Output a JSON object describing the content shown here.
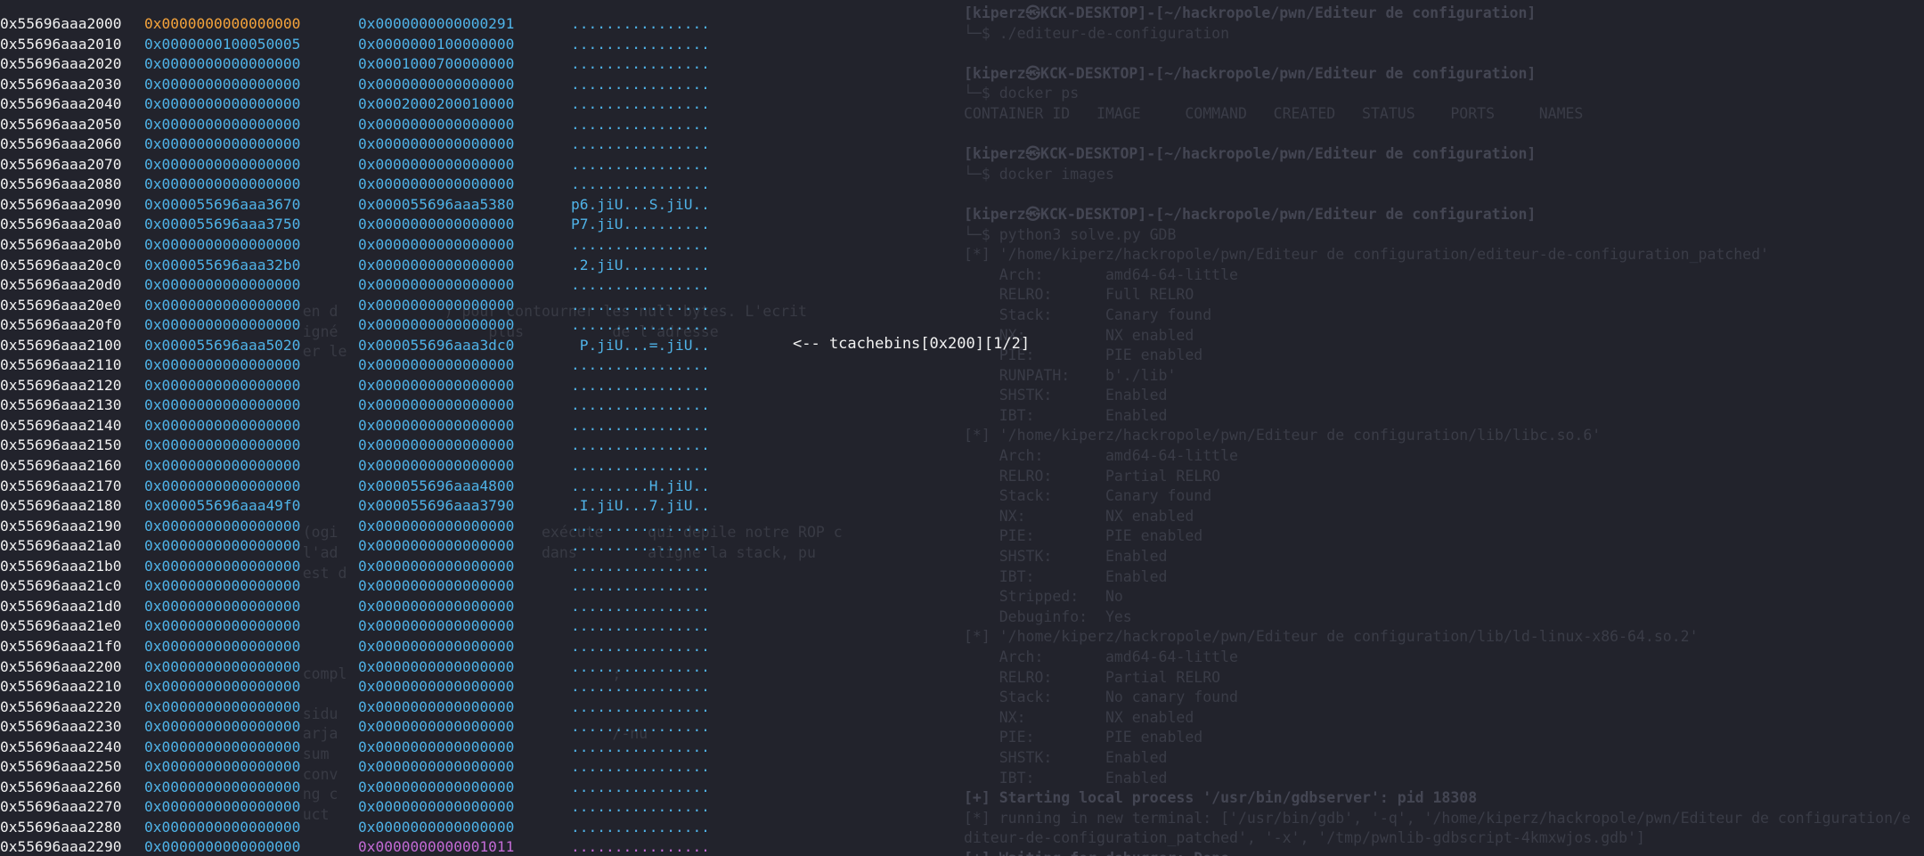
{
  "hexdump": {
    "rows": [
      {
        "addr": "0x55696aaa2000",
        "q1": "0x0000000000000000",
        "q2": "0x0000000000000291",
        "ascii": "................"
      },
      {
        "addr": "0x55696aaa2010",
        "q1": "0x0000000100050005",
        "q2": "0x0000000100000000",
        "ascii": "................"
      },
      {
        "addr": "0x55696aaa2020",
        "q1": "0x0000000000000000",
        "q2": "0x0001000700000000",
        "ascii": "................"
      },
      {
        "addr": "0x55696aaa2030",
        "q1": "0x0000000000000000",
        "q2": "0x0000000000000000",
        "ascii": "................"
      },
      {
        "addr": "0x55696aaa2040",
        "q1": "0x0000000000000000",
        "q2": "0x0002000200010000",
        "ascii": "................"
      },
      {
        "addr": "0x55696aaa2050",
        "q1": "0x0000000000000000",
        "q2": "0x0000000000000000",
        "ascii": "................"
      },
      {
        "addr": "0x55696aaa2060",
        "q1": "0x0000000000000000",
        "q2": "0x0000000000000000",
        "ascii": "................"
      },
      {
        "addr": "0x55696aaa2070",
        "q1": "0x0000000000000000",
        "q2": "0x0000000000000000",
        "ascii": "................"
      },
      {
        "addr": "0x55696aaa2080",
        "q1": "0x0000000000000000",
        "q2": "0x0000000000000000",
        "ascii": "................"
      },
      {
        "addr": "0x55696aaa2090",
        "q1": "0x000055696aaa3670",
        "q2": "0x000055696aaa5380",
        "ascii": "p6.jiU...S.jiU.."
      },
      {
        "addr": "0x55696aaa20a0",
        "q1": "0x000055696aaa3750",
        "q2": "0x0000000000000000",
        "ascii": "P7.jiU.........."
      },
      {
        "addr": "0x55696aaa20b0",
        "q1": "0x0000000000000000",
        "q2": "0x0000000000000000",
        "ascii": "................"
      },
      {
        "addr": "0x55696aaa20c0",
        "q1": "0x000055696aaa32b0",
        "q2": "0x0000000000000000",
        "ascii": ".2.jiU.........."
      },
      {
        "addr": "0x55696aaa20d0",
        "q1": "0x0000000000000000",
        "q2": "0x0000000000000000",
        "ascii": "................"
      },
      {
        "addr": "0x55696aaa20e0",
        "q1": "0x0000000000000000",
        "q2": "0x0000000000000000",
        "ascii": "................"
      },
      {
        "addr": "0x55696aaa20f0",
        "q1": "0x0000000000000000",
        "q2": "0x0000000000000000",
        "ascii": "................"
      },
      {
        "addr": "0x55696aaa2100",
        "q1": "0x000055696aaa5020",
        "q2": "0x000055696aaa3dc0",
        "ascii": " P.jiU...=.jiU.."
      },
      {
        "addr": "0x55696aaa2110",
        "q1": "0x0000000000000000",
        "q2": "0x0000000000000000",
        "ascii": "................"
      },
      {
        "addr": "0x55696aaa2120",
        "q1": "0x0000000000000000",
        "q2": "0x0000000000000000",
        "ascii": "................"
      },
      {
        "addr": "0x55696aaa2130",
        "q1": "0x0000000000000000",
        "q2": "0x0000000000000000",
        "ascii": "................"
      },
      {
        "addr": "0x55696aaa2140",
        "q1": "0x0000000000000000",
        "q2": "0x0000000000000000",
        "ascii": "................"
      },
      {
        "addr": "0x55696aaa2150",
        "q1": "0x0000000000000000",
        "q2": "0x0000000000000000",
        "ascii": "................"
      },
      {
        "addr": "0x55696aaa2160",
        "q1": "0x0000000000000000",
        "q2": "0x0000000000000000",
        "ascii": "................"
      },
      {
        "addr": "0x55696aaa2170",
        "q1": "0x0000000000000000",
        "q2": "0x000055696aaa4800",
        "ascii": ".........H.jiU.."
      },
      {
        "addr": "0x55696aaa2180",
        "q1": "0x000055696aaa49f0",
        "q2": "0x000055696aaa3790",
        "ascii": ".I.jiU...7.jiU.."
      },
      {
        "addr": "0x55696aaa2190",
        "q1": "0x0000000000000000",
        "q2": "0x0000000000000000",
        "ascii": "................"
      },
      {
        "addr": "0x55696aaa21a0",
        "q1": "0x0000000000000000",
        "q2": "0x0000000000000000",
        "ascii": "................"
      },
      {
        "addr": "0x55696aaa21b0",
        "q1": "0x0000000000000000",
        "q2": "0x0000000000000000",
        "ascii": "................"
      },
      {
        "addr": "0x55696aaa21c0",
        "q1": "0x0000000000000000",
        "q2": "0x0000000000000000",
        "ascii": "................"
      },
      {
        "addr": "0x55696aaa21d0",
        "q1": "0x0000000000000000",
        "q2": "0x0000000000000000",
        "ascii": "................"
      },
      {
        "addr": "0x55696aaa21e0",
        "q1": "0x0000000000000000",
        "q2": "0x0000000000000000",
        "ascii": "................"
      },
      {
        "addr": "0x55696aaa21f0",
        "q1": "0x0000000000000000",
        "q2": "0x0000000000000000",
        "ascii": "................"
      },
      {
        "addr": "0x55696aaa2200",
        "q1": "0x0000000000000000",
        "q2": "0x0000000000000000",
        "ascii": "................"
      },
      {
        "addr": "0x55696aaa2210",
        "q1": "0x0000000000000000",
        "q2": "0x0000000000000000",
        "ascii": "................"
      },
      {
        "addr": "0x55696aaa2220",
        "q1": "0x0000000000000000",
        "q2": "0x0000000000000000",
        "ascii": "................"
      },
      {
        "addr": "0x55696aaa2230",
        "q1": "0x0000000000000000",
        "q2": "0x0000000000000000",
        "ascii": "................"
      },
      {
        "addr": "0x55696aaa2240",
        "q1": "0x0000000000000000",
        "q2": "0x0000000000000000",
        "ascii": "................"
      },
      {
        "addr": "0x55696aaa2250",
        "q1": "0x0000000000000000",
        "q2": "0x0000000000000000",
        "ascii": "................"
      },
      {
        "addr": "0x55696aaa2260",
        "q1": "0x0000000000000000",
        "q2": "0x0000000000000000",
        "ascii": "................"
      },
      {
        "addr": "0x55696aaa2270",
        "q1": "0x0000000000000000",
        "q2": "0x0000000000000000",
        "ascii": "................"
      },
      {
        "addr": "0x55696aaa2280",
        "q1": "0x0000000000000000",
        "q2": "0x0000000000000000",
        "ascii": "................"
      },
      {
        "addr": "0x55696aaa2290",
        "q1": "0x0000000000000000",
        "q2": "0x0000000000001011",
        "ascii": "................"
      }
    ],
    "annotation": "<-- tcachebins[0x200][1/2]"
  },
  "colors": {
    "background": "#22232c",
    "address": "#f2f2f2",
    "value": "#4fb3e8",
    "chunk_header": "#f5a33b",
    "top_chunk": "#c46bd6"
  },
  "background_terminal": {
    "right": [
      "[kiperz㉿KCK-DESKTOP]-[~/hackropole/pwn/Editeur de configuration]",
      "└─$ ./editeur-de-configuration",
      "",
      "[kiperz㉿KCK-DESKTOP]-[~/hackropole/pwn/Editeur de configuration]",
      "└─$ docker ps",
      "CONTAINER ID   IMAGE     COMMAND   CREATED   STATUS    PORTS     NAMES",
      "",
      "[kiperz㉿KCK-DESKTOP]-[~/hackropole/pwn/Editeur de configuration]",
      "└─$ docker images",
      "",
      "[kiperz㉿KCK-DESKTOP]-[~/hackropole/pwn/Editeur de configuration]",
      "└─$ python3 solve.py GDB",
      "[*] '/home/kiperz/hackropole/pwn/Editeur de configuration/editeur-de-configuration_patched'",
      "    Arch:       amd64-64-little",
      "    RELRO:      Full RELRO",
      "    Stack:      Canary found",
      "    NX:         NX enabled",
      "    PIE:        PIE enabled",
      "    RUNPATH:    b'./lib'",
      "    SHSTK:      Enabled",
      "    IBT:        Enabled",
      "[*] '/home/kiperz/hackropole/pwn/Editeur de configuration/lib/libc.so.6'",
      "    Arch:       amd64-64-little",
      "    RELRO:      Partial RELRO",
      "    Stack:      Canary found",
      "    NX:         NX enabled",
      "    PIE:        PIE enabled",
      "    SHSTK:      Enabled",
      "    IBT:        Enabled",
      "    Stripped:   No",
      "    Debuginfo:  Yes",
      "[*] '/home/kiperz/hackropole/pwn/Editeur de configuration/lib/ld-linux-x86-64.so.2'",
      "    Arch:       amd64-64-little",
      "    RELRO:      Partial RELRO",
      "    Stack:      No canary found",
      "    NX:         NX enabled",
      "    PIE:        PIE enabled",
      "    SHSTK:      Enabled",
      "    IBT:        Enabled",
      "[+] Starting local process '/usr/bin/gdbserver': pid 18308",
      "[*] running in new terminal: ['/usr/bin/gdb', '-q', '/home/kiperz/hackropole/pwn/Editeur de configuration/e",
      "diteur-de-configuration_patched', '-x', '/tmp/pwnlib-gdbscript-4kmxwjos.gdb']",
      "[+] Waiting for debugger: Done"
    ],
    "left": [
      "",
      "",
      "",
      "",
      "",
      "",
      "",
      "",
      "",
      "",
      "",
      "",
      "",
      "",
      "",
      "    en d            ) pour contourner les null bytes. L'ecrit",
      "    igné                 plus          de l'adresse",
      "    er le",
      "",
      "",
      "",
      "",
      "",
      "",
      "",
      "",
      "    (ogi                       exécute     qui depile notre ROP c",
      "    l'ad                       dans        aligne la stack, pu",
      "    est d",
      "",
      "",
      "",
      "",
      "    compl                              ;",
      "",
      "    sidu",
      "    arja                               /-nu",
      "    sum",
      "    conv",
      "    ng c",
      "    uct"
    ]
  }
}
